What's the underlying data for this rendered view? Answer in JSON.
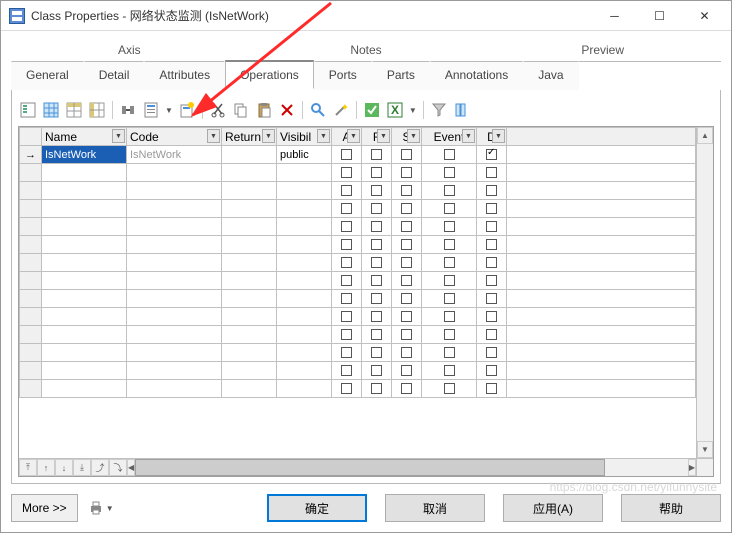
{
  "window": {
    "title": "Class Properties - 网络状态监测 (IsNetWork)"
  },
  "stubTabs": [
    "Axis",
    "Notes",
    "Preview"
  ],
  "tabs": [
    "General",
    "Detail",
    "Attributes",
    "Operations",
    "Ports",
    "Parts",
    "Annotations",
    "Java"
  ],
  "activeTab": "Operations",
  "grid": {
    "columns": [
      "Name",
      "Code",
      "Return",
      "Visibil",
      "A",
      "F",
      "S",
      "Event",
      "D"
    ],
    "rows": [
      {
        "name": "IsNetWork",
        "code": "IsNetWork",
        "return": "",
        "visibility": "public",
        "a": false,
        "f": false,
        "s": false,
        "event": false,
        "d": true
      }
    ],
    "blankRows": 13
  },
  "footer": {
    "more": "More >>",
    "ok": "确定",
    "cancel": "取消",
    "apply": "应用(A)",
    "help": "帮助"
  },
  "watermark": "https://blog.csdn.net/yifunnysite"
}
